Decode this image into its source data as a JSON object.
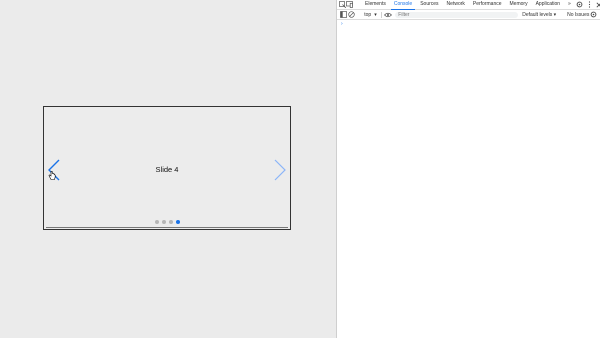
{
  "page": {
    "slide": {
      "label": "Slide 4",
      "total": 4,
      "active_index": 3
    }
  },
  "devtools": {
    "tabs": [
      {
        "label": "Elements",
        "active": false
      },
      {
        "label": "Console",
        "active": true
      },
      {
        "label": "Sources",
        "active": false
      },
      {
        "label": "Network",
        "active": false
      },
      {
        "label": "Performance",
        "active": false
      },
      {
        "label": "Memory",
        "active": false
      },
      {
        "label": "Application",
        "active": false
      }
    ],
    "more_tabs_glyph": "»",
    "toolbar": {
      "context": "top",
      "context_caret": "▾",
      "filter_placeholder": "Filter",
      "levels": "Default levels ▾",
      "issues": "No Issues"
    },
    "prompt": "›"
  },
  "colors": {
    "accent": "#1a73e8",
    "page_bg": "#ebebeb",
    "dot_inactive": "#b6b6b6"
  }
}
